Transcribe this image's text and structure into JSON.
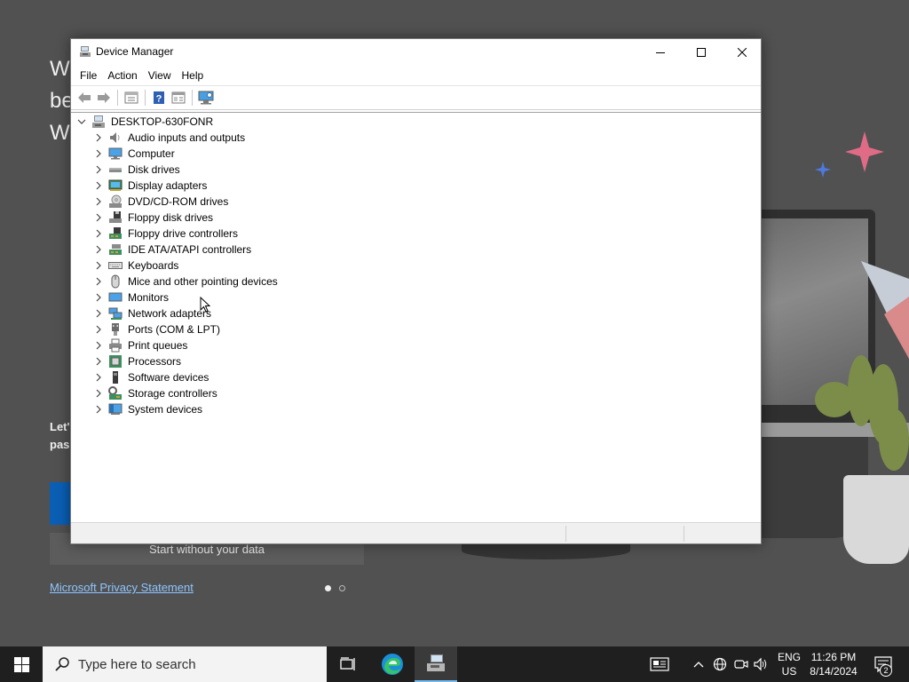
{
  "background": {
    "heading_lines": [
      "W",
      "be",
      "W"
    ],
    "small_lines": [
      "Let'",
      "pas"
    ],
    "start_button_label": "Start without your data",
    "privacy_link": "Microsoft Privacy Statement"
  },
  "window": {
    "title": "Device Manager",
    "controls": {
      "minimize": "—",
      "maximize": "☐",
      "close": "✕"
    },
    "menu": [
      "File",
      "Action",
      "View",
      "Help"
    ],
    "toolbar_icons": [
      "back-icon",
      "forward-icon",
      "properties-icon",
      "help-icon",
      "details-icon",
      "scan-hardware-icon"
    ]
  },
  "tree": {
    "root": {
      "label": "DESKTOP-630FONR",
      "icon": "computer-icon",
      "expanded": true
    },
    "items": [
      {
        "label": "Audio inputs and outputs",
        "icon": "speaker-icon"
      },
      {
        "label": "Computer",
        "icon": "monitor-icon"
      },
      {
        "label": "Disk drives",
        "icon": "disk-drive-icon"
      },
      {
        "label": "Display adapters",
        "icon": "display-adapter-icon"
      },
      {
        "label": "DVD/CD-ROM drives",
        "icon": "dvd-icon"
      },
      {
        "label": "Floppy disk drives",
        "icon": "floppy-icon"
      },
      {
        "label": "Floppy drive controllers",
        "icon": "controller-icon"
      },
      {
        "label": "IDE ATA/ATAPI controllers",
        "icon": "controller-icon"
      },
      {
        "label": "Keyboards",
        "icon": "keyboard-icon"
      },
      {
        "label": "Mice and other pointing devices",
        "icon": "mouse-icon"
      },
      {
        "label": "Monitors",
        "icon": "monitor-icon"
      },
      {
        "label": "Network adapters",
        "icon": "network-icon"
      },
      {
        "label": "Ports (COM & LPT)",
        "icon": "port-icon"
      },
      {
        "label": "Print queues",
        "icon": "printer-icon"
      },
      {
        "label": "Processors",
        "icon": "processor-icon"
      },
      {
        "label": "Software devices",
        "icon": "software-device-icon"
      },
      {
        "label": "Storage controllers",
        "icon": "storage-icon"
      },
      {
        "label": "System devices",
        "icon": "system-icon"
      }
    ]
  },
  "taskbar": {
    "search_placeholder": "Type here to search",
    "language_top": "ENG",
    "language_bottom": "US",
    "time": "11:26 PM",
    "date": "8/14/2024",
    "notification_count": "2"
  },
  "colors": {
    "accent": "#0078d4",
    "taskbar": "#1f1f1f",
    "window_bg": "#ffffff"
  }
}
